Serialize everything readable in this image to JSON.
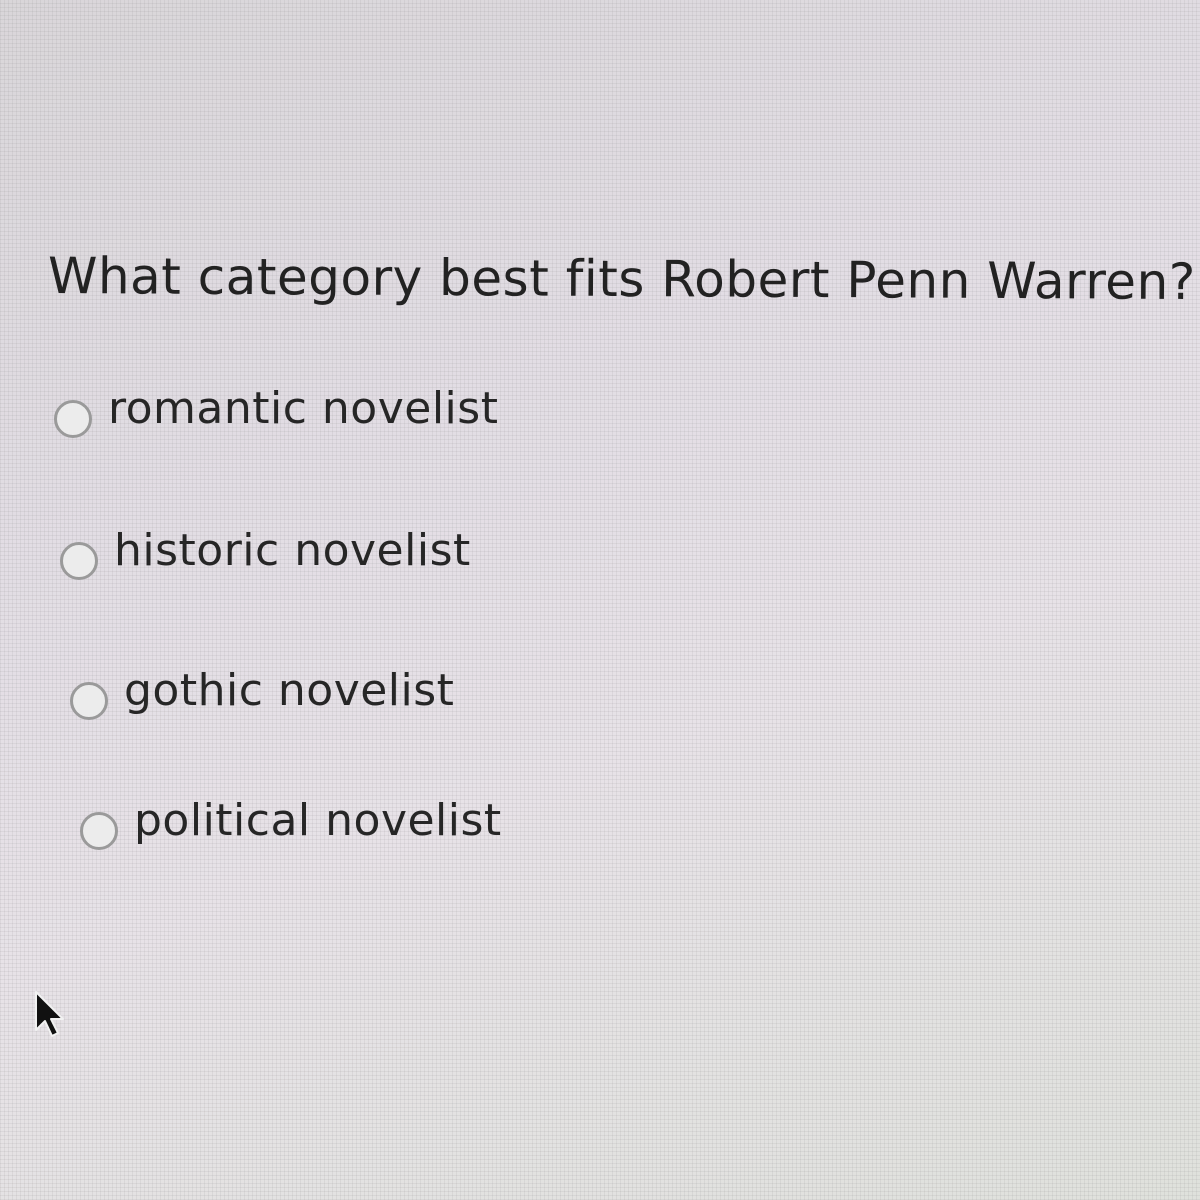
{
  "quiz": {
    "question": "What category best fits Robert Penn Warren?",
    "options": [
      {
        "label": "romantic novelist",
        "selected": false
      },
      {
        "label": "historic novelist",
        "selected": false
      },
      {
        "label": "gothic novelist",
        "selected": false
      },
      {
        "label": "political novelist",
        "selected": false
      }
    ]
  },
  "cursor": {
    "icon": "mouse-pointer-icon"
  }
}
